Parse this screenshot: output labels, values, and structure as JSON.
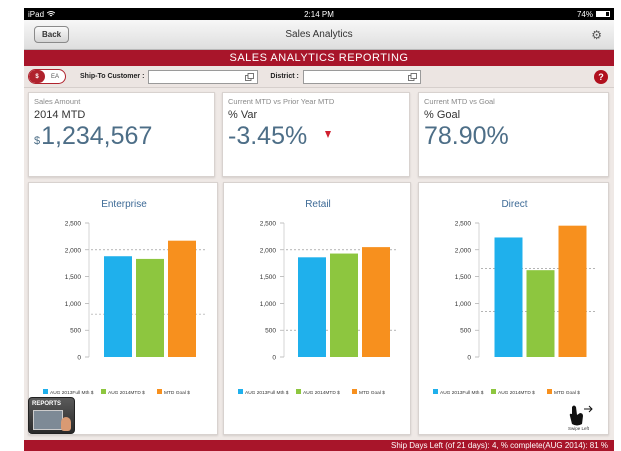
{
  "status_bar": {
    "device": "iPad",
    "time": "2:14 PM",
    "battery": "74%"
  },
  "nav": {
    "back_label": "Back",
    "title": "Sales Analytics",
    "settings_icon": "gear-icon"
  },
  "banner": {
    "title": "SALES ANALYTICS REPORTING"
  },
  "filters": {
    "toggle_on": "$",
    "toggle_off": "EA",
    "ship_to_label": "Ship-To Customer :",
    "ship_to_value": "",
    "district_label": "District :",
    "district_value": "",
    "help_label": "?"
  },
  "kpis": [
    {
      "caption": "Sales Amount",
      "subtitle": "2014 MTD",
      "prefix": "$",
      "value": "1,234,567"
    },
    {
      "caption": "Current MTD vs Prior Year MTD",
      "subtitle": "% Var",
      "value": "-3.45%",
      "trend_icon": "arrow-down-icon"
    },
    {
      "caption": "Current MTD vs Goal",
      "subtitle": "% Goal",
      "value": "78.90%"
    }
  ],
  "footer": {
    "text": "Ship Days Left (of 21 days): 4, % complete(AUG 2014): 81 %"
  },
  "reports_tile": {
    "label": "REPORTS"
  },
  "swipe": {
    "label": "Swipe Left"
  },
  "colors": {
    "brand": "#a8152a",
    "series1": "#1fb0ec",
    "series2": "#8dc63f",
    "series3": "#f7901e",
    "kpi_value": "#4d6e87"
  },
  "chart_data": [
    {
      "type": "bar",
      "title": "Enterprise",
      "categories": [
        "AUG 2013Full Mth $",
        "AUG 2014MTD $",
        "MTD Goal $"
      ],
      "values": [
        1880,
        1830,
        2170
      ],
      "ylim": [
        0,
        2500
      ],
      "yticks": [
        "0",
        "500",
        "1,000",
        "1,500",
        "2,000",
        "2,500"
      ],
      "dashed_lines": [
        800,
        2000
      ],
      "legend": [
        "AUG 2013Full Mth $",
        "AUG 2014MTD $",
        "MTD Goal $"
      ],
      "legend_placement": "bottom",
      "grid": false
    },
    {
      "type": "bar",
      "title": "Retail",
      "categories": [
        "AUG 2013Full Mth $",
        "AUG 2014MTD $",
        "MTD Goal $"
      ],
      "values": [
        1860,
        1930,
        2050
      ],
      "ylim": [
        0,
        2500
      ],
      "yticks": [
        "0",
        "500",
        "1,000",
        "1,500",
        "2,000",
        "2,500"
      ],
      "dashed_lines": [
        500,
        2000
      ],
      "legend": [
        "AUG 2013Full Mth $",
        "AUG 2014MTD $",
        "MTD Goal $"
      ],
      "legend_placement": "bottom",
      "grid": false
    },
    {
      "type": "bar",
      "title": "Direct",
      "categories": [
        "AUG 2013Full Mth $",
        "AUG 2014MTD $",
        "MTD Goal $"
      ],
      "values": [
        2230,
        1620,
        2450
      ],
      "ylim": [
        0,
        2500
      ],
      "yticks": [
        "0",
        "500",
        "1,000",
        "1,500",
        "2,000",
        "2,500"
      ],
      "dashed_lines": [
        850,
        1650
      ],
      "legend": [
        "AUG 2013Full Mth $",
        "AUG 2014MTD $",
        "MTD Goal $"
      ],
      "legend_placement": "bottom",
      "grid": false
    }
  ]
}
